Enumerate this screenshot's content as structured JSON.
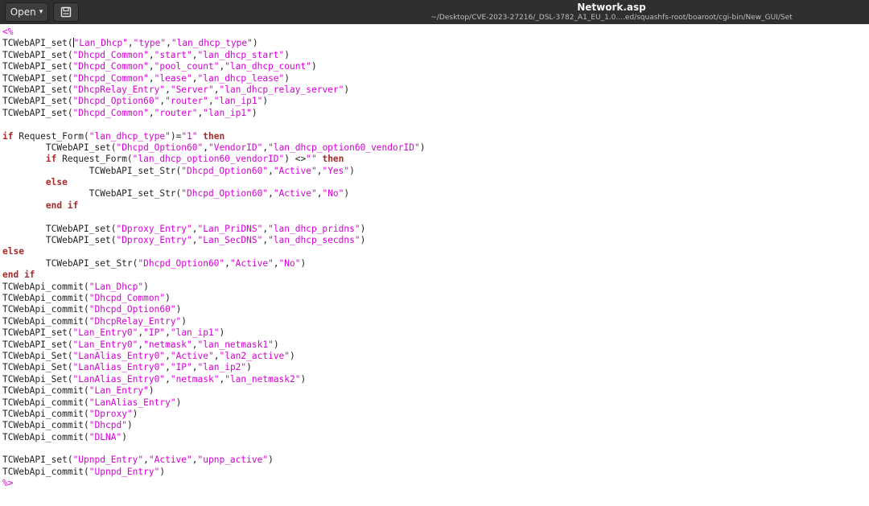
{
  "window": {
    "title": "Network.asp",
    "path": "~/Desktop/CVE-2023-27216/_DSL-3782_A1_EU_1.0....ed/squashfs-root/boaroot/cgi-bin/New_GUI/Set"
  },
  "toolbar": {
    "open_label": "Open",
    "open_caret_icon": "chevron-down-icon",
    "doc_icon": "new-document-icon"
  },
  "colors": {
    "titlebar": "#2f2f2f",
    "string": "#d600d6",
    "keyword": "#a52a2a",
    "text": "#222222"
  },
  "editor": {
    "cursor_after_line": 1,
    "lines": [
      [
        [
          "<%",
          "delim"
        ]
      ],
      [
        [
          "TCWebAPI_set(",
          "plain"
        ],
        [
          "\"Lan_Dhcp\"",
          "str"
        ],
        [
          ",",
          "plain"
        ],
        [
          "\"type\"",
          "str"
        ],
        [
          ",",
          "plain"
        ],
        [
          "\"lan_dhcp_type\"",
          "str"
        ],
        [
          ")",
          "plain"
        ]
      ],
      [
        [
          "TCWebAPI_set(",
          "plain"
        ],
        [
          "\"Dhcpd_Common\"",
          "str"
        ],
        [
          ",",
          "plain"
        ],
        [
          "\"start\"",
          "str"
        ],
        [
          ",",
          "plain"
        ],
        [
          "\"lan_dhcp_start\"",
          "str"
        ],
        [
          ")",
          "plain"
        ]
      ],
      [
        [
          "TCWebAPI_set(",
          "plain"
        ],
        [
          "\"Dhcpd_Common\"",
          "str"
        ],
        [
          ",",
          "plain"
        ],
        [
          "\"pool_count\"",
          "str"
        ],
        [
          ",",
          "plain"
        ],
        [
          "\"lan_dhcp_count\"",
          "str"
        ],
        [
          ")",
          "plain"
        ]
      ],
      [
        [
          "TCWebAPI_set(",
          "plain"
        ],
        [
          "\"Dhcpd_Common\"",
          "str"
        ],
        [
          ",",
          "plain"
        ],
        [
          "\"lease\"",
          "str"
        ],
        [
          ",",
          "plain"
        ],
        [
          "\"lan_dhcp_lease\"",
          "str"
        ],
        [
          ")",
          "plain"
        ]
      ],
      [
        [
          "TCWebAPI_set(",
          "plain"
        ],
        [
          "\"DhcpRelay_Entry\"",
          "str"
        ],
        [
          ",",
          "plain"
        ],
        [
          "\"Server\"",
          "str"
        ],
        [
          ",",
          "plain"
        ],
        [
          "\"lan_dhcp_relay_server\"",
          "str"
        ],
        [
          ")",
          "plain"
        ]
      ],
      [
        [
          "TCWebAPI_set(",
          "plain"
        ],
        [
          "\"Dhcpd_Option60\"",
          "str"
        ],
        [
          ",",
          "plain"
        ],
        [
          "\"router\"",
          "str"
        ],
        [
          ",",
          "plain"
        ],
        [
          "\"lan_ip1\"",
          "str"
        ],
        [
          ")",
          "plain"
        ]
      ],
      [
        [
          "TCWebAPI_set(",
          "plain"
        ],
        [
          "\"Dhcpd_Common\"",
          "str"
        ],
        [
          ",",
          "plain"
        ],
        [
          "\"router\"",
          "str"
        ],
        [
          ",",
          "plain"
        ],
        [
          "\"lan_ip1\"",
          "str"
        ],
        [
          ")",
          "plain"
        ]
      ],
      [],
      [
        [
          "if",
          "kw"
        ],
        [
          " Request_Form(",
          "plain"
        ],
        [
          "\"lan_dhcp_type\"",
          "str"
        ],
        [
          ")=",
          "plain"
        ],
        [
          "\"1\"",
          "str"
        ],
        [
          " ",
          "plain"
        ],
        [
          "then",
          "kw"
        ]
      ],
      [
        [
          "        TCWebAPI_set(",
          "plain"
        ],
        [
          "\"Dhcpd_Option60\"",
          "str"
        ],
        [
          ",",
          "plain"
        ],
        [
          "\"VendorID\"",
          "str"
        ],
        [
          ",",
          "plain"
        ],
        [
          "\"lan_dhcp_option60_vendorID\"",
          "str"
        ],
        [
          ")",
          "plain"
        ]
      ],
      [
        [
          "        ",
          "plain"
        ],
        [
          "if",
          "kw"
        ],
        [
          " Request_Form(",
          "plain"
        ],
        [
          "\"lan_dhcp_option60_vendorID\"",
          "str"
        ],
        [
          ") <>",
          "plain"
        ],
        [
          "\"\"",
          "str"
        ],
        [
          " ",
          "plain"
        ],
        [
          "then",
          "kw"
        ]
      ],
      [
        [
          "                TCWebAPI_set_Str(",
          "plain"
        ],
        [
          "\"Dhcpd_Option60\"",
          "str"
        ],
        [
          ",",
          "plain"
        ],
        [
          "\"Active\"",
          "str"
        ],
        [
          ",",
          "plain"
        ],
        [
          "\"Yes\"",
          "str"
        ],
        [
          ")",
          "plain"
        ]
      ],
      [
        [
          "        ",
          "plain"
        ],
        [
          "else",
          "kw"
        ]
      ],
      [
        [
          "                TCWebAPI_set_Str(",
          "plain"
        ],
        [
          "\"Dhcpd_Option60\"",
          "str"
        ],
        [
          ",",
          "plain"
        ],
        [
          "\"Active\"",
          "str"
        ],
        [
          ",",
          "plain"
        ],
        [
          "\"No\"",
          "str"
        ],
        [
          ")",
          "plain"
        ]
      ],
      [
        [
          "        ",
          "plain"
        ],
        [
          "end if",
          "kw"
        ]
      ],
      [],
      [
        [
          "        TCWebAPI_set(",
          "plain"
        ],
        [
          "\"Dproxy_Entry\"",
          "str"
        ],
        [
          ",",
          "plain"
        ],
        [
          "\"Lan_PriDNS\"",
          "str"
        ],
        [
          ",",
          "plain"
        ],
        [
          "\"lan_dhcp_pridns\"",
          "str"
        ],
        [
          ")",
          "plain"
        ]
      ],
      [
        [
          "        TCWebAPI_set(",
          "plain"
        ],
        [
          "\"Dproxy_Entry\"",
          "str"
        ],
        [
          ",",
          "plain"
        ],
        [
          "\"Lan_SecDNS\"",
          "str"
        ],
        [
          ",",
          "plain"
        ],
        [
          "\"lan_dhcp_secdns\"",
          "str"
        ],
        [
          ")",
          "plain"
        ]
      ],
      [
        [
          "else",
          "kw"
        ]
      ],
      [
        [
          "        TCWebAPI_set_Str(",
          "plain"
        ],
        [
          "\"Dhcpd_Option60\"",
          "str"
        ],
        [
          ",",
          "plain"
        ],
        [
          "\"Active\"",
          "str"
        ],
        [
          ",",
          "plain"
        ],
        [
          "\"No\"",
          "str"
        ],
        [
          ")",
          "plain"
        ]
      ],
      [
        [
          "end if",
          "kw"
        ]
      ],
      [
        [
          "TCWebApi_commit(",
          "plain"
        ],
        [
          "\"Lan_Dhcp\"",
          "str"
        ],
        [
          ")",
          "plain"
        ]
      ],
      [
        [
          "TCWebApi_commit(",
          "plain"
        ],
        [
          "\"Dhcpd_Common\"",
          "str"
        ],
        [
          ")",
          "plain"
        ]
      ],
      [
        [
          "TCWebApi_commit(",
          "plain"
        ],
        [
          "\"Dhcpd_Option60\"",
          "str"
        ],
        [
          ")",
          "plain"
        ]
      ],
      [
        [
          "TCWebApi_commit(",
          "plain"
        ],
        [
          "\"DhcpRelay_Entry\"",
          "str"
        ],
        [
          ")",
          "plain"
        ]
      ],
      [
        [
          "TCWebAPI_set(",
          "plain"
        ],
        [
          "\"Lan_Entry0\"",
          "str"
        ],
        [
          ",",
          "plain"
        ],
        [
          "\"IP\"",
          "str"
        ],
        [
          ",",
          "plain"
        ],
        [
          "\"lan_ip1\"",
          "str"
        ],
        [
          ")",
          "plain"
        ]
      ],
      [
        [
          "TCWebAPI_set(",
          "plain"
        ],
        [
          "\"Lan_Entry0\"",
          "str"
        ],
        [
          ",",
          "plain"
        ],
        [
          "\"netmask\"",
          "str"
        ],
        [
          ",",
          "plain"
        ],
        [
          "\"lan_netmask1\"",
          "str"
        ],
        [
          ")",
          "plain"
        ]
      ],
      [
        [
          "TCWebApi_Set(",
          "plain"
        ],
        [
          "\"LanAlias_Entry0\"",
          "str"
        ],
        [
          ",",
          "plain"
        ],
        [
          "\"Active\"",
          "str"
        ],
        [
          ",",
          "plain"
        ],
        [
          "\"lan2_active\"",
          "str"
        ],
        [
          ")",
          "plain"
        ]
      ],
      [
        [
          "TCWebApi_Set(",
          "plain"
        ],
        [
          "\"LanAlias_Entry0\"",
          "str"
        ],
        [
          ",",
          "plain"
        ],
        [
          "\"IP\"",
          "str"
        ],
        [
          ",",
          "plain"
        ],
        [
          "\"lan_ip2\"",
          "str"
        ],
        [
          ")",
          "plain"
        ]
      ],
      [
        [
          "TCWebApi_Set(",
          "plain"
        ],
        [
          "\"LanAlias_Entry0\"",
          "str"
        ],
        [
          ",",
          "plain"
        ],
        [
          "\"netmask\"",
          "str"
        ],
        [
          ",",
          "plain"
        ],
        [
          "\"lan_netmask2\"",
          "str"
        ],
        [
          ")",
          "plain"
        ]
      ],
      [
        [
          "TCWebApi_commit(",
          "plain"
        ],
        [
          "\"Lan_Entry\"",
          "str"
        ],
        [
          ")",
          "plain"
        ]
      ],
      [
        [
          "TCWebApi_commit(",
          "plain"
        ],
        [
          "\"LanAlias_Entry\"",
          "str"
        ],
        [
          ")",
          "plain"
        ]
      ],
      [
        [
          "TCWebApi_commit(",
          "plain"
        ],
        [
          "\"Dproxy\"",
          "str"
        ],
        [
          ")",
          "plain"
        ]
      ],
      [
        [
          "TCWebApi_commit(",
          "plain"
        ],
        [
          "\"Dhcpd\"",
          "str"
        ],
        [
          ")",
          "plain"
        ]
      ],
      [
        [
          "TCWebApi_commit(",
          "plain"
        ],
        [
          "\"DLNA\"",
          "str"
        ],
        [
          ")",
          "plain"
        ]
      ],
      [],
      [
        [
          "TCWebAPI_set(",
          "plain"
        ],
        [
          "\"Upnpd_Entry\"",
          "str"
        ],
        [
          ",",
          "plain"
        ],
        [
          "\"Active\"",
          "str"
        ],
        [
          ",",
          "plain"
        ],
        [
          "\"upnp_active\"",
          "str"
        ],
        [
          ")",
          "plain"
        ]
      ],
      [
        [
          "TCWebApi_commit(",
          "plain"
        ],
        [
          "\"Upnpd_Entry\"",
          "str"
        ],
        [
          ")",
          "plain"
        ]
      ],
      [
        [
          "%>",
          "delim"
        ]
      ]
    ]
  }
}
